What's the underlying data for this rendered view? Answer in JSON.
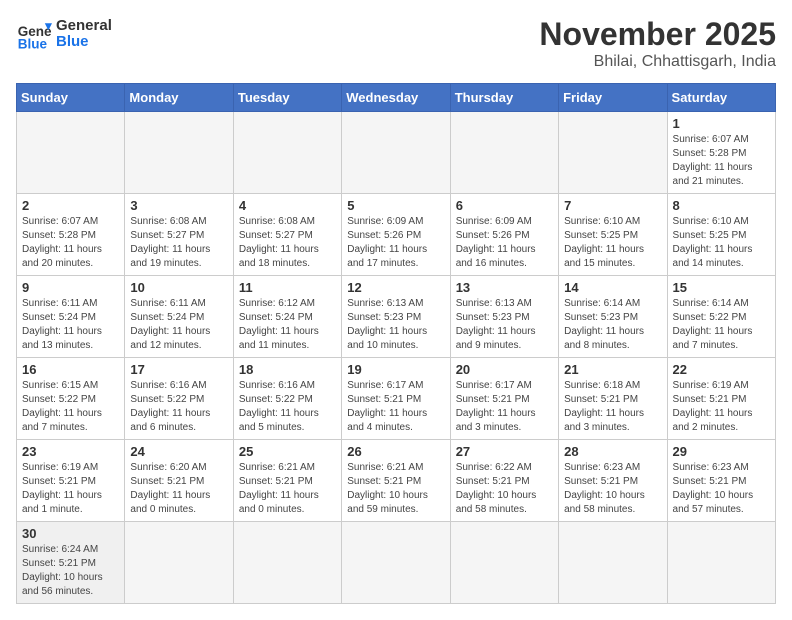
{
  "header": {
    "logo_general": "General",
    "logo_blue": "Blue",
    "month_title": "November 2025",
    "location": "Bhilai, Chhattisgarh, India"
  },
  "weekdays": [
    "Sunday",
    "Monday",
    "Tuesday",
    "Wednesday",
    "Thursday",
    "Friday",
    "Saturday"
  ],
  "days": [
    {
      "num": "",
      "info": ""
    },
    {
      "num": "",
      "info": ""
    },
    {
      "num": "",
      "info": ""
    },
    {
      "num": "",
      "info": ""
    },
    {
      "num": "",
      "info": ""
    },
    {
      "num": "",
      "info": ""
    },
    {
      "num": "1",
      "info": "Sunrise: 6:07 AM\nSunset: 5:28 PM\nDaylight: 11 hours\nand 21 minutes."
    },
    {
      "num": "2",
      "info": "Sunrise: 6:07 AM\nSunset: 5:28 PM\nDaylight: 11 hours\nand 20 minutes."
    },
    {
      "num": "3",
      "info": "Sunrise: 6:08 AM\nSunset: 5:27 PM\nDaylight: 11 hours\nand 19 minutes."
    },
    {
      "num": "4",
      "info": "Sunrise: 6:08 AM\nSunset: 5:27 PM\nDaylight: 11 hours\nand 18 minutes."
    },
    {
      "num": "5",
      "info": "Sunrise: 6:09 AM\nSunset: 5:26 PM\nDaylight: 11 hours\nand 17 minutes."
    },
    {
      "num": "6",
      "info": "Sunrise: 6:09 AM\nSunset: 5:26 PM\nDaylight: 11 hours\nand 16 minutes."
    },
    {
      "num": "7",
      "info": "Sunrise: 6:10 AM\nSunset: 5:25 PM\nDaylight: 11 hours\nand 15 minutes."
    },
    {
      "num": "8",
      "info": "Sunrise: 6:10 AM\nSunset: 5:25 PM\nDaylight: 11 hours\nand 14 minutes."
    },
    {
      "num": "9",
      "info": "Sunrise: 6:11 AM\nSunset: 5:24 PM\nDaylight: 11 hours\nand 13 minutes."
    },
    {
      "num": "10",
      "info": "Sunrise: 6:11 AM\nSunset: 5:24 PM\nDaylight: 11 hours\nand 12 minutes."
    },
    {
      "num": "11",
      "info": "Sunrise: 6:12 AM\nSunset: 5:24 PM\nDaylight: 11 hours\nand 11 minutes."
    },
    {
      "num": "12",
      "info": "Sunrise: 6:13 AM\nSunset: 5:23 PM\nDaylight: 11 hours\nand 10 minutes."
    },
    {
      "num": "13",
      "info": "Sunrise: 6:13 AM\nSunset: 5:23 PM\nDaylight: 11 hours\nand 9 minutes."
    },
    {
      "num": "14",
      "info": "Sunrise: 6:14 AM\nSunset: 5:23 PM\nDaylight: 11 hours\nand 8 minutes."
    },
    {
      "num": "15",
      "info": "Sunrise: 6:14 AM\nSunset: 5:22 PM\nDaylight: 11 hours\nand 7 minutes."
    },
    {
      "num": "16",
      "info": "Sunrise: 6:15 AM\nSunset: 5:22 PM\nDaylight: 11 hours\nand 7 minutes."
    },
    {
      "num": "17",
      "info": "Sunrise: 6:16 AM\nSunset: 5:22 PM\nDaylight: 11 hours\nand 6 minutes."
    },
    {
      "num": "18",
      "info": "Sunrise: 6:16 AM\nSunset: 5:22 PM\nDaylight: 11 hours\nand 5 minutes."
    },
    {
      "num": "19",
      "info": "Sunrise: 6:17 AM\nSunset: 5:21 PM\nDaylight: 11 hours\nand 4 minutes."
    },
    {
      "num": "20",
      "info": "Sunrise: 6:17 AM\nSunset: 5:21 PM\nDaylight: 11 hours\nand 3 minutes."
    },
    {
      "num": "21",
      "info": "Sunrise: 6:18 AM\nSunset: 5:21 PM\nDaylight: 11 hours\nand 3 minutes."
    },
    {
      "num": "22",
      "info": "Sunrise: 6:19 AM\nSunset: 5:21 PM\nDaylight: 11 hours\nand 2 minutes."
    },
    {
      "num": "23",
      "info": "Sunrise: 6:19 AM\nSunset: 5:21 PM\nDaylight: 11 hours\nand 1 minute."
    },
    {
      "num": "24",
      "info": "Sunrise: 6:20 AM\nSunset: 5:21 PM\nDaylight: 11 hours\nand 0 minutes."
    },
    {
      "num": "25",
      "info": "Sunrise: 6:21 AM\nSunset: 5:21 PM\nDaylight: 11 hours\nand 0 minutes."
    },
    {
      "num": "26",
      "info": "Sunrise: 6:21 AM\nSunset: 5:21 PM\nDaylight: 10 hours\nand 59 minutes."
    },
    {
      "num": "27",
      "info": "Sunrise: 6:22 AM\nSunset: 5:21 PM\nDaylight: 10 hours\nand 58 minutes."
    },
    {
      "num": "28",
      "info": "Sunrise: 6:23 AM\nSunset: 5:21 PM\nDaylight: 10 hours\nand 58 minutes."
    },
    {
      "num": "29",
      "info": "Sunrise: 6:23 AM\nSunset: 5:21 PM\nDaylight: 10 hours\nand 57 minutes."
    },
    {
      "num": "30",
      "info": "Sunrise: 6:24 AM\nSunset: 5:21 PM\nDaylight: 10 hours\nand 56 minutes."
    },
    {
      "num": "",
      "info": ""
    },
    {
      "num": "",
      "info": ""
    },
    {
      "num": "",
      "info": ""
    },
    {
      "num": "",
      "info": ""
    },
    {
      "num": "",
      "info": ""
    },
    {
      "num": "",
      "info": ""
    }
  ]
}
